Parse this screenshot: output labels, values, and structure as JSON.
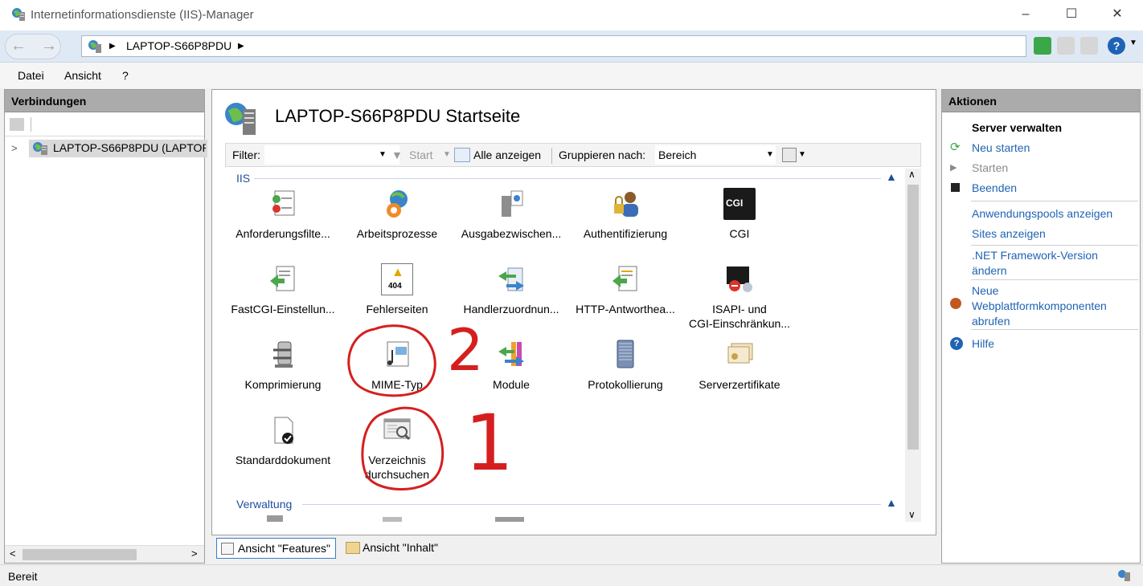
{
  "window": {
    "title": "Internetinformationsdienste (IIS)-Manager"
  },
  "address": {
    "crumb": "LAPTOP-S66P8PDU"
  },
  "menu": {
    "file": "Datei",
    "view": "Ansicht",
    "help": "?"
  },
  "connections": {
    "header": "Verbindungen",
    "tree_node": "LAPTOP-S66P8PDU (LAPTOP-"
  },
  "center": {
    "title": "LAPTOP-S66P8PDU Startseite",
    "filter_label": "Filter:",
    "start_label": "Start",
    "show_all_label": "Alle anzeigen",
    "group_by_label": "Gruppieren nach:",
    "group_by_value": "Bereich",
    "section_iis": "IIS",
    "section_management": "Verwaltung",
    "features": [
      "Anforderungsfilte...",
      "Arbeitsprozesse",
      "Ausgabezwischen...",
      "Authentifizierung",
      "CGI",
      "FastCGI-Einstellun...",
      "Fehlerseiten",
      "Handlerzuordnun...",
      "HTTP-Antworthea...",
      "ISAPI- und\nCGI-Einschränkun...",
      "Komprimierung",
      "MIME-Typ",
      "Module",
      "Protokollierung",
      "Serverzertifikate",
      "Standarddokument",
      "Verzeichnis\ndurchsuchen"
    ],
    "cgi_text": "CGI",
    "err_text": "404"
  },
  "view_tabs": {
    "features": "Ansicht \"Features\"",
    "content": "Ansicht \"Inhalt\""
  },
  "actions": {
    "header": "Aktionen",
    "section_title": "Server verwalten",
    "restart": "Neu starten",
    "start": "Starten",
    "stop": "Beenden",
    "app_pools": "Anwendungspools anzeigen",
    "sites": "Sites anzeigen",
    "net_framework": ".NET Framework-Version ändern",
    "new_components": "Neue Webplattformkomponenten abrufen",
    "help": "Hilfe"
  },
  "status": {
    "text": "Bereit"
  },
  "annotations": {
    "one": "1",
    "two": "2"
  },
  "colors": {
    "annotation": "#d51f1f",
    "link": "#1f63b4",
    "panel_header": "#ababab"
  }
}
